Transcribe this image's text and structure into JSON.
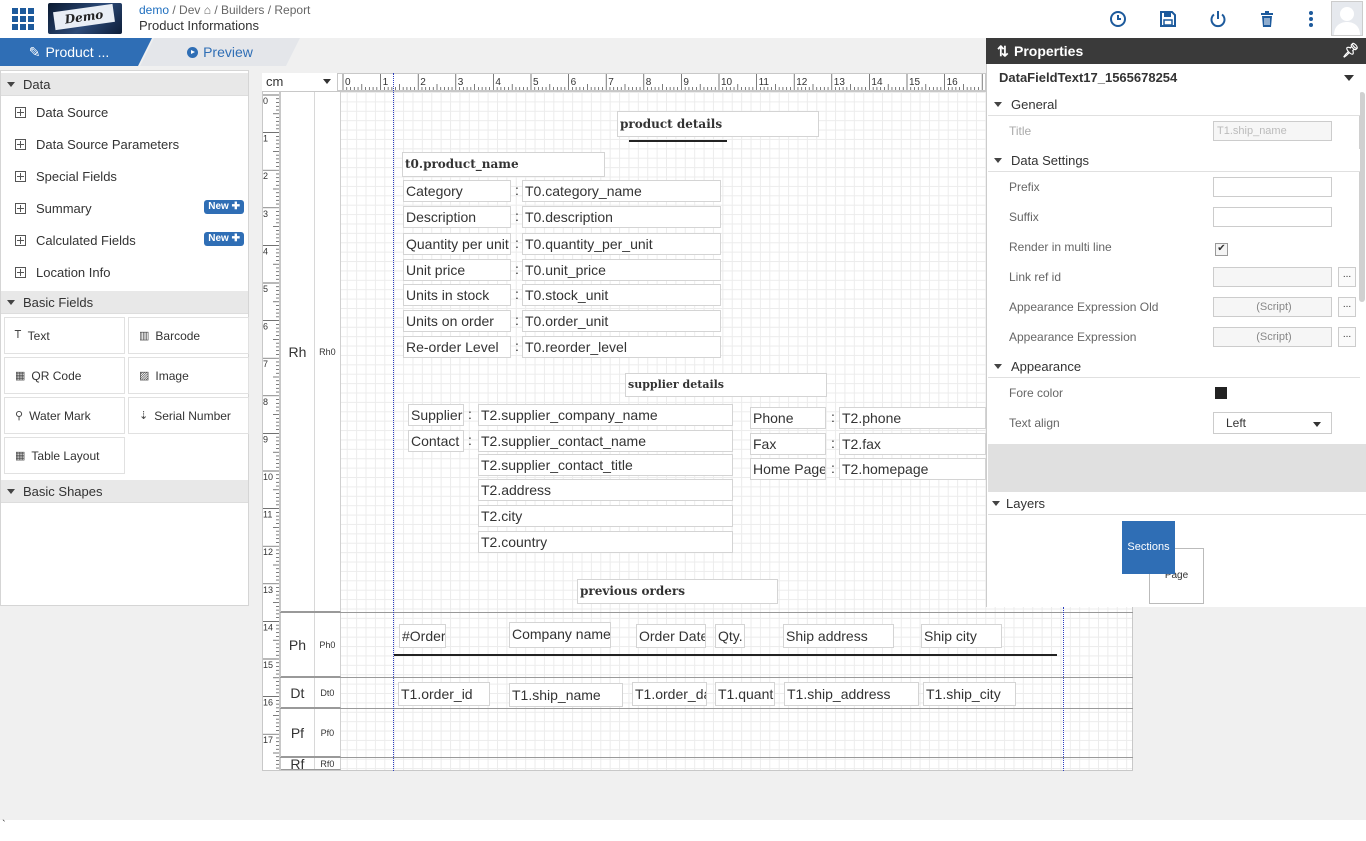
{
  "breadcrumb": {
    "demo": "demo",
    "dev": "Dev",
    "builders": "Builders",
    "report": "Report"
  },
  "page_title": "Product Informations",
  "logo_text": "Demo",
  "tabs": {
    "design": "Product ...",
    "preview": "Preview"
  },
  "left": {
    "data_section": "Data",
    "data_items": [
      {
        "label": "Data Source"
      },
      {
        "label": "Data Source Parameters"
      },
      {
        "label": "Special Fields"
      },
      {
        "label": "Summary",
        "badge": "New"
      },
      {
        "label": "Calculated Fields",
        "badge": "New"
      },
      {
        "label": "Location Info"
      }
    ],
    "basic_fields_section": "Basic Fields",
    "basic_fields": [
      {
        "label": "Text",
        "icon": "text-icon"
      },
      {
        "label": "Barcode",
        "icon": "barcode-icon"
      },
      {
        "label": "QR Code",
        "icon": "qr-code-icon"
      },
      {
        "label": "Image",
        "icon": "image-icon"
      },
      {
        "label": "Water Mark",
        "icon": "watermark-icon"
      },
      {
        "label": "Serial Number",
        "icon": "serial-number-icon"
      },
      {
        "label": "Table Layout",
        "icon": "table-layout-icon"
      }
    ],
    "basic_shapes_section": "Basic Shapes"
  },
  "canvas": {
    "unit": "cm",
    "ruler_h": [
      "0",
      "1",
      "2",
      "3",
      "4",
      "5",
      "6",
      "7",
      "8",
      "9",
      "10",
      "11",
      "12",
      "13",
      "14",
      "15",
      "16"
    ],
    "ruler_v": [
      "0",
      "1",
      "2",
      "3",
      "4",
      "5",
      "6",
      "7",
      "8",
      "9",
      "10",
      "11",
      "12",
      "13",
      "14",
      "15",
      "16",
      "17"
    ],
    "bands": [
      {
        "short": "Rh",
        "id": "Rh0"
      },
      {
        "short": "Ph",
        "id": "Ph0"
      },
      {
        "short": "Dt",
        "id": "Dt0"
      },
      {
        "short": "Pf",
        "id": "Pf0"
      },
      {
        "short": "Rf",
        "id": "Rf0"
      }
    ],
    "headings": {
      "product_details": "product details",
      "product_name": "t0.product_name",
      "supplier_details": "supplier details",
      "previous_orders": "previous orders"
    },
    "product_rows": [
      {
        "label": "Category",
        "value": "T0.category_name"
      },
      {
        "label": "Description",
        "value": "T0.description"
      },
      {
        "label": "Quantity per unit",
        "value": "T0.quantity_per_unit"
      },
      {
        "label": "Unit price",
        "value": "T0.unit_price"
      },
      {
        "label": "Units in stock",
        "value": "T0.stock_unit"
      },
      {
        "label": "Units on order",
        "value": "T0.order_unit"
      },
      {
        "label": "Re-order Level",
        "value": "T0.reorder_level"
      }
    ],
    "colon": ":",
    "supplier": {
      "supplier_label": "Supplier",
      "contact_label": "Contact",
      "fields": [
        "T2.supplier_company_name",
        "T2.supplier_contact_name",
        "T2.supplier_contact_title",
        "T2.address",
        "T2.city",
        "T2.country"
      ],
      "phone_label": "Phone",
      "fax_label": "Fax",
      "homepage_label": "Home Page",
      "phone": "T2.phone",
      "fax": "T2.fax",
      "homepage": "T2.homepage"
    },
    "page_header": [
      "#Order",
      "Company name",
      "Order Date",
      "Qty.",
      "Ship address",
      "Ship city"
    ],
    "detail": [
      "T1.order_id",
      "T1.ship_name",
      "T1.order_da",
      "T1.quant",
      "T1.ship_address",
      "T1.ship_city"
    ]
  },
  "properties": {
    "title": "Properties",
    "object": "DataFieldText17_1565678254",
    "general": "General",
    "title_label": "Title",
    "title_value": "T1.ship_name",
    "data_settings": "Data Settings",
    "prefix": "Prefix",
    "suffix": "Suffix",
    "render_multi": "Render in multi line",
    "link_ref": "Link ref id",
    "appearance_expr_old": "Appearance Expression Old",
    "appearance_expr": "Appearance Expression",
    "script": "(Script)",
    "dots": "...",
    "appearance": "Appearance",
    "fore_color": "Fore color",
    "fore_color_value": "#222222",
    "text_align": "Text align",
    "text_align_value": "Left",
    "layers": "Layers",
    "sections": "Sections",
    "page": "Page"
  },
  "colors": {
    "accent": "#2f6eb5",
    "header": "#3a3a3a",
    "link": "#1f6fbf"
  },
  "footer_tick": "`"
}
